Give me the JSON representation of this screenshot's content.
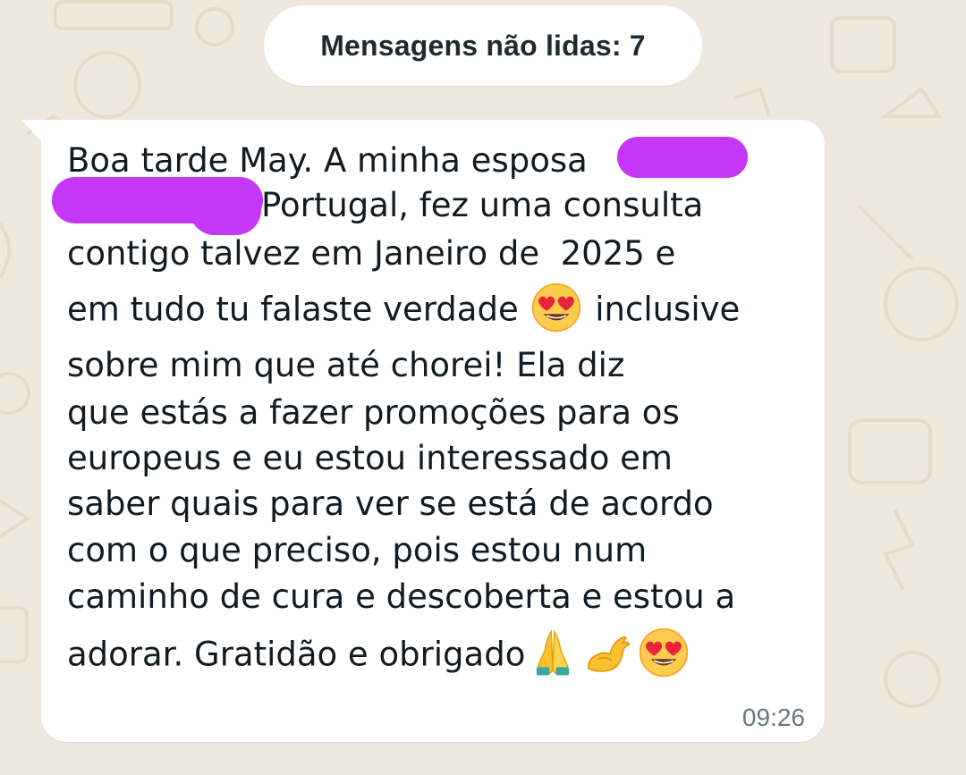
{
  "banner": {
    "unread_label": "Mensagens não lidas: 7"
  },
  "message": {
    "line1": "Boa tarde May. A minha esposa",
    "line2": "Portugal, fez uma consulta",
    "line3": "contigo talvez em Janeiro de  2025 e",
    "line4_a": "em tudo tu falaste verdade ",
    "line4_b": " inclusive",
    "line5": "sobre mim que até chorei! Ela diz",
    "line6": "que estás a fazer promoções para os",
    "line7": "europeus e eu estou interessado em",
    "line8": "saber quais para ver se está de acordo",
    "line9": "com o que preciso, pois estou num",
    "line10": "caminho de cura e descoberta e estou a",
    "line11": "adorar. Gratidão e obrigado",
    "time": "09:26",
    "emojis": [
      "heart-eyes-emoji",
      "folded-hands-emoji",
      "flexed-biceps-emoji",
      "heart-eyes-emoji"
    ]
  },
  "colors": {
    "wallpaper": "#efe9dd",
    "bubble": "#ffffff",
    "text": "#111b21",
    "timestamp": "#667781",
    "redaction": "#c637f5"
  }
}
